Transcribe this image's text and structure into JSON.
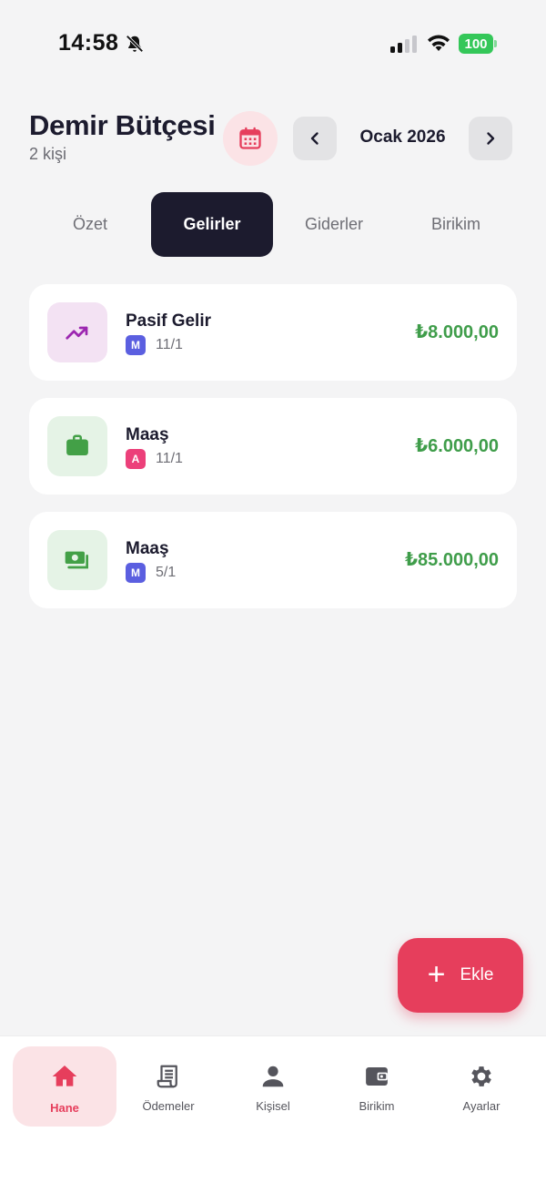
{
  "status_bar": {
    "time": "14:58",
    "battery": "100"
  },
  "header": {
    "title": "Demir Bütçesi",
    "subtitle": "2 kişi",
    "month": "Ocak 2026"
  },
  "tabs": [
    {
      "label": "Özet",
      "active": false
    },
    {
      "label": "Gelirler",
      "active": true
    },
    {
      "label": "Giderler",
      "active": false
    },
    {
      "label": "Birikim",
      "active": false
    }
  ],
  "incomes": [
    {
      "title": "Pasif Gelir",
      "member": "M",
      "date": "11/1",
      "amount": "₺8.000,00",
      "icon": "trending-up-icon",
      "icon_bg": "#f3e2f3",
      "icon_color": "#9c27b0",
      "badge_color": "#5b5fe0"
    },
    {
      "title": "Maaş",
      "member": "A",
      "date": "11/1",
      "amount": "₺6.000,00",
      "icon": "briefcase-icon",
      "icon_bg": "#e5f3e6",
      "icon_color": "#43a047",
      "badge_color": "#ec407a"
    },
    {
      "title": "Maaş",
      "member": "M",
      "date": "5/1",
      "amount": "₺85.000,00",
      "icon": "money-icon",
      "icon_bg": "#e5f3e6",
      "icon_color": "#43a047",
      "badge_color": "#5b5fe0"
    }
  ],
  "fab": {
    "label": "Ekle"
  },
  "bottom_nav": [
    {
      "label": "Hane",
      "icon": "home-icon",
      "active": true
    },
    {
      "label": "Ödemeler",
      "icon": "receipt-icon",
      "active": false
    },
    {
      "label": "Kişisel",
      "icon": "person-icon",
      "active": false
    },
    {
      "label": "Birikim",
      "icon": "wallet-icon",
      "active": false
    },
    {
      "label": "Ayarlar",
      "icon": "gear-icon",
      "active": false
    }
  ],
  "colors": {
    "accent": "#e63e5c",
    "dark": "#1c1b2e",
    "income": "#3f9d4a"
  }
}
